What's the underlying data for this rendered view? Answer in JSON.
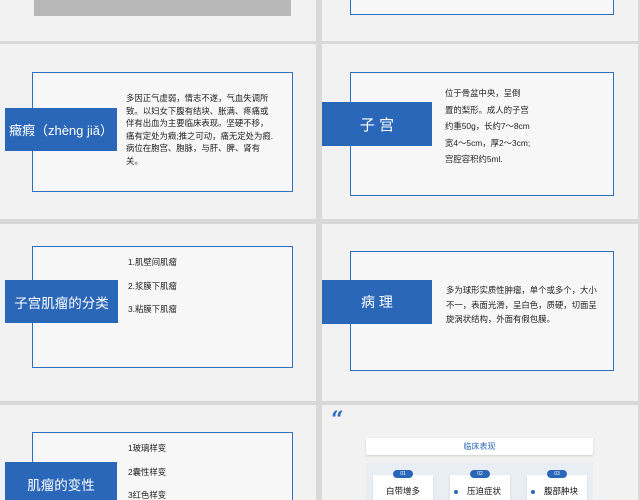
{
  "slides": {
    "s2_definition": {
      "title": "癥瘕（zhèng jiǎ）",
      "text": "多因正气虚弱，情志不遂，气血失调所致。以妇女下腹有结块、胀满、疼痛或伴有出血为主要临床表现。坚硬不移，痛有定处为癥;推之可动，痛无定处为瘕.病位在胞宫、胞脉，与肝、脾、肾有关。"
    },
    "s3_uterus": {
      "title": "子 宫",
      "lines": [
        "位于骨盆中央，呈倒",
        "置的梨形。成人的子宫",
        "约重50g，长约7～8cm",
        "宽4～5cm，厚2～3cm;",
        "宫腔容积约5ml."
      ]
    },
    "s4_classification": {
      "title": "子宫肌瘤的分类",
      "items": [
        "1.肌壁间肌瘤",
        "2.浆膜下肌瘤",
        "3.粘膜下肌瘤"
      ]
    },
    "s5_pathology": {
      "title": "病 理",
      "text": "多为球形实质性肿瘤，单个或多个，大小不一，表面光滑，呈白色，质硬，切面呈旋涡状结构，外面有假包膜。"
    },
    "s6_degeneration": {
      "title": "肌瘤的变性",
      "items": [
        "1玻璃样变",
        "2囊性样变",
        "3红色样变"
      ]
    },
    "s7_clinical": {
      "quote_mark": "“",
      "title": "临床表现",
      "symptoms": [
        {
          "tag": "01",
          "text": "白带增多"
        },
        {
          "tag": "02",
          "text": "压迫症状"
        },
        {
          "tag": "03",
          "text": "腹部肿块"
        }
      ]
    }
  }
}
